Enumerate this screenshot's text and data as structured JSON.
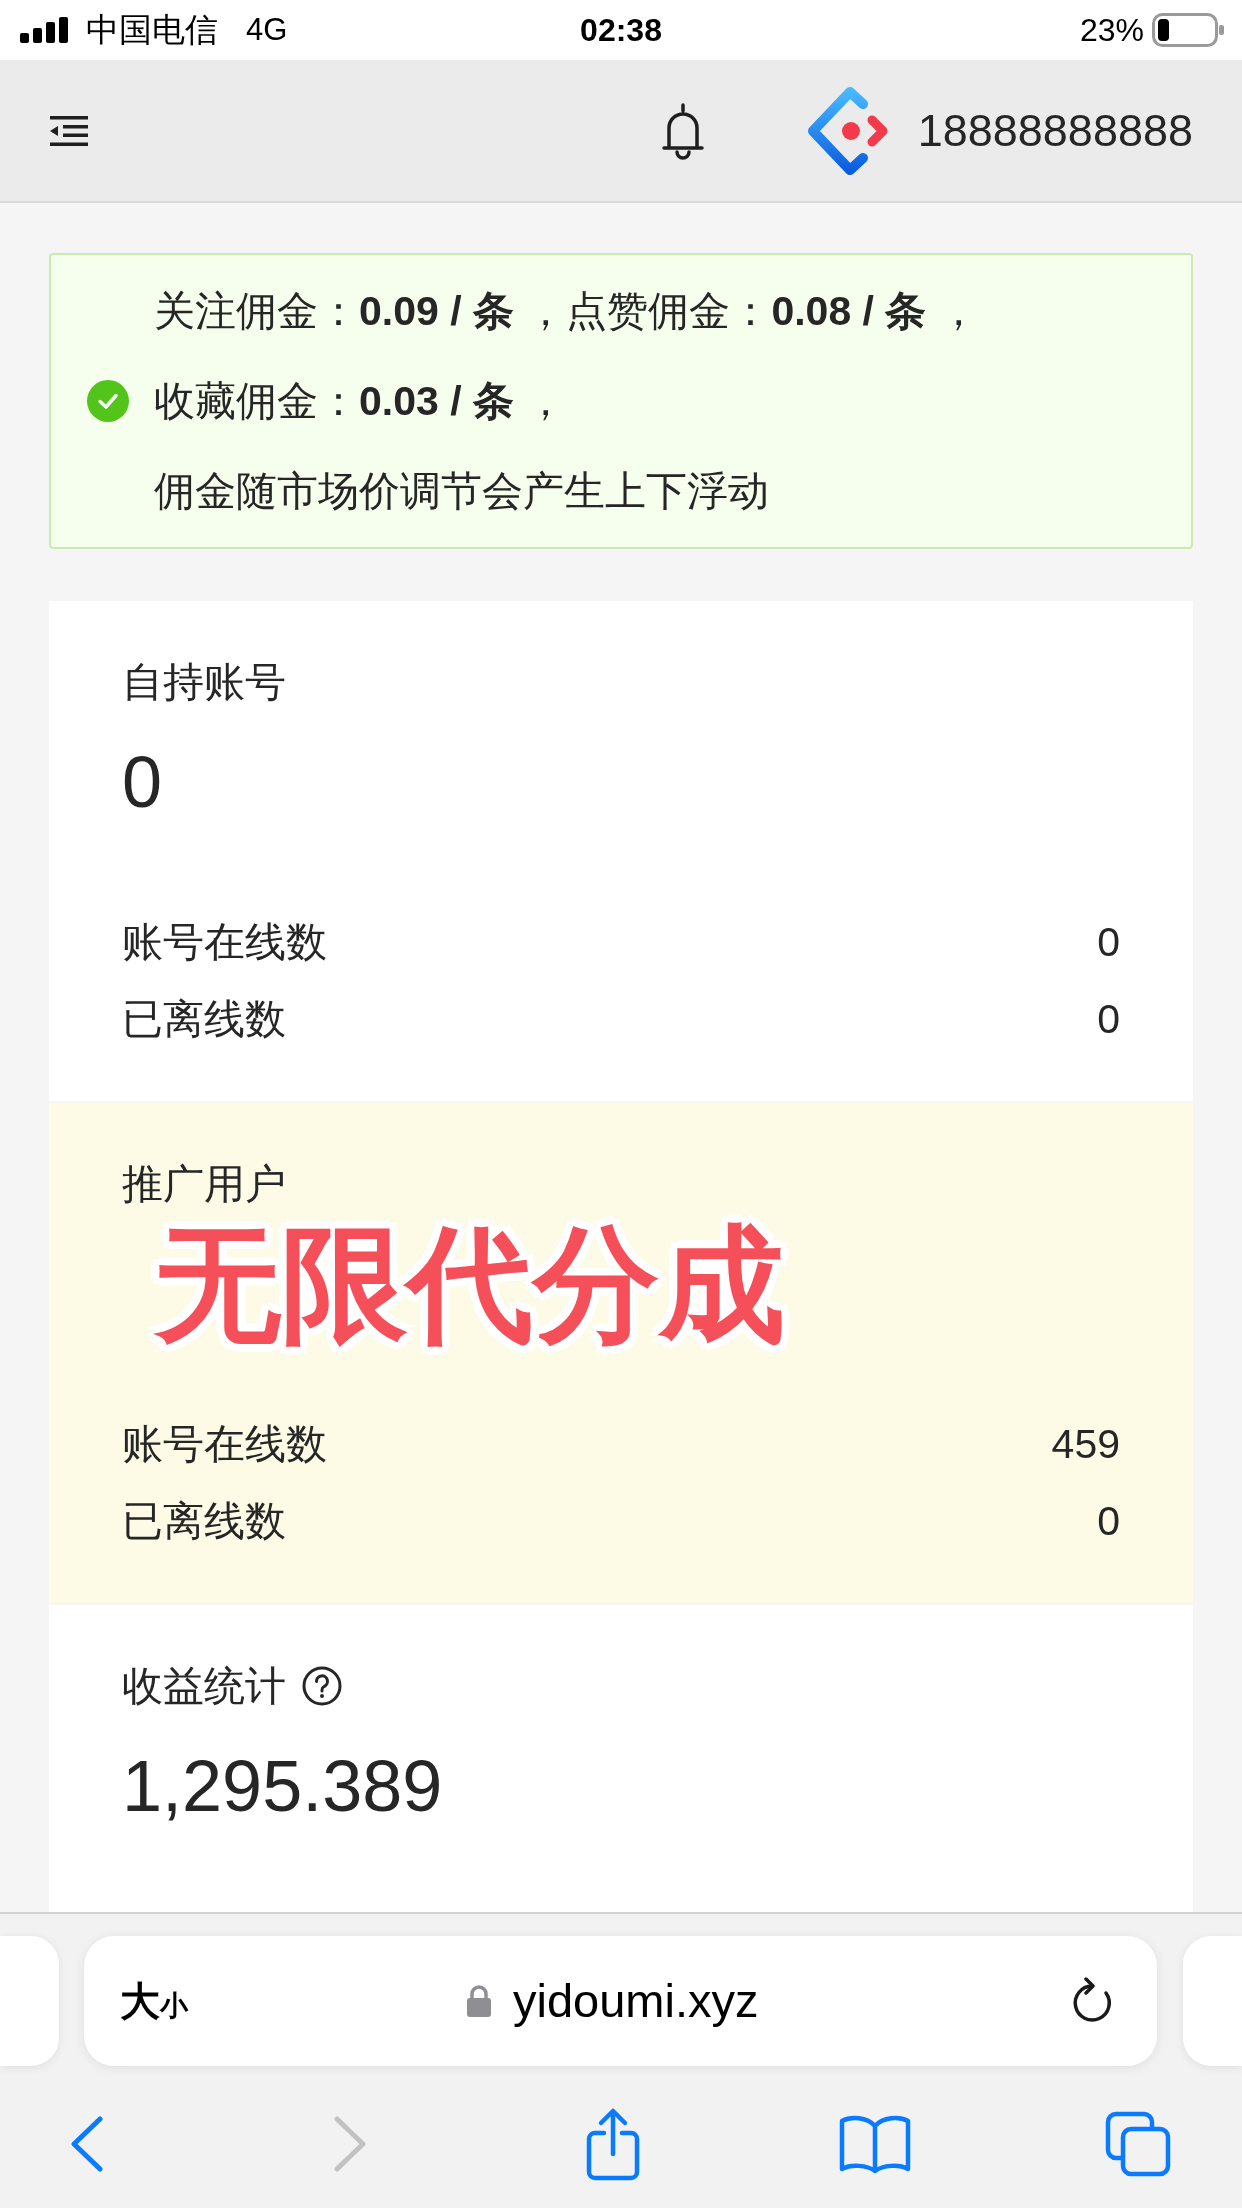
{
  "status_bar": {
    "carrier": "中国电信",
    "network": "4G",
    "time": "02:38",
    "battery": "23%"
  },
  "header": {
    "account": "18888888888"
  },
  "notice": {
    "lines": [
      "关注佣金：**0.09 / 条** ，点赞佣金：**0.08 / 条** ，",
      "收藏佣金：**0.03 / 条** ，",
      "佣金随市场价调节会产生上下浮动"
    ]
  },
  "cards": [
    {
      "title": "自持账号",
      "highlighted": false,
      "value": "0",
      "rows": [
        {
          "label": "账号在线数",
          "value": "0"
        },
        {
          "label": "已离线数",
          "value": "0"
        }
      ]
    },
    {
      "title": "推广用户",
      "highlighted": true,
      "overlay_caption": "无限代分成",
      "rows": [
        {
          "label": "账号在线数",
          "value": "459"
        },
        {
          "label": "已离线数",
          "value": "0"
        }
      ]
    },
    {
      "title": "收益统计",
      "highlighted": false,
      "help_icon": true,
      "value": "1,295.389"
    }
  ],
  "browser": {
    "text_size": {
      "large": "大",
      "small": "小"
    },
    "url": "yidoumi.xyz",
    "toolbar": [
      {
        "kind": "back",
        "disabled": false
      },
      {
        "kind": "forward",
        "disabled": true
      },
      {
        "kind": "share",
        "disabled": false
      },
      {
        "kind": "bookmarks",
        "disabled": false
      },
      {
        "kind": "tabs",
        "disabled": false
      }
    ]
  }
}
